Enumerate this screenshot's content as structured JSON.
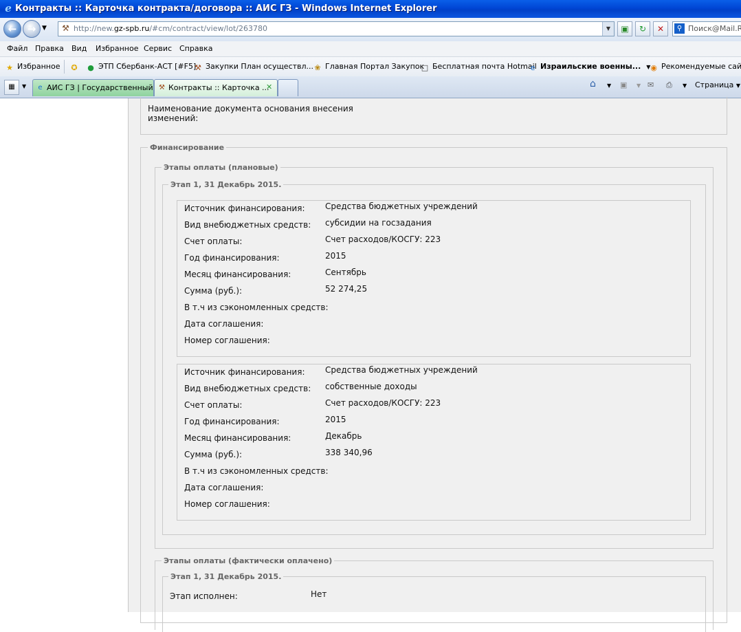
{
  "window": {
    "title": "Контракты :: Карточка контракта/договора :: АИС ГЗ - Windows Internet Explorer"
  },
  "address": {
    "url_prefix": "http://new.",
    "url_domain": "gz-spb.ru",
    "url_path": "/#cm/contract/view/lot/263780"
  },
  "search": {
    "placeholder": "Поиск@Mail.Ru"
  },
  "menu": [
    "Файл",
    "Правка",
    "Вид",
    "Избранное",
    "Сервис",
    "Справка"
  ],
  "favorites": {
    "label": "Избранное",
    "items": [
      "ЭТП Сбербанк-АСТ [#F5]",
      "Закупки  План осуществл...",
      "Главная Портал Закупок",
      "Бесплатная почта Hotmail",
      "Израильские военны...",
      "Рекомендуемые сайты"
    ]
  },
  "tabs": [
    {
      "label": "АИС ГЗ | Государственный ..."
    },
    {
      "label": "Контракты :: Карточка ..."
    }
  ],
  "commandbar": {
    "page_label": "Страница"
  },
  "doc_basis": {
    "label_line1": "Наименование документа основания внесения",
    "label_line2": "изменений:"
  },
  "financing": {
    "legend": "Финансирование",
    "planned": {
      "legend": "Этапы оплаты (плановые)",
      "stage_legend": "Этап 1, 31 Декабрь 2015.",
      "blocks": [
        {
          "source_label": "Источник финансирования:",
          "source": "Средства бюджетных учреждений",
          "kind_label": "Вид внебюджетных средств:",
          "kind": "субсидии на госзадания",
          "account_label": "Счет оплаты:",
          "account": "Счет расходов/КОСГУ: 223",
          "year_label": "Год финансирования:",
          "year": "2015",
          "month_label": "Месяц финансирования:",
          "month": "Сентябрь",
          "sum_label": "Сумма (руб.):",
          "sum": "52 274,25",
          "saved_label": "В т.ч из сэкономленных средств:",
          "agreement_date_label": "Дата соглашения:",
          "agreement_no_label": "Номер соглашения:"
        },
        {
          "source_label": "Источник финансирования:",
          "source": "Средства бюджетных учреждений",
          "kind_label": "Вид внебюджетных средств:",
          "kind": "собственные доходы",
          "account_label": "Счет оплаты:",
          "account": "Счет расходов/КОСГУ: 223",
          "year_label": "Год финансирования:",
          "year": "2015",
          "month_label": "Месяц финансирования:",
          "month": "Декабрь",
          "sum_label": "Сумма (руб.):",
          "sum": "338 340,96",
          "saved_label": "В т.ч из сэкономленных средств:",
          "agreement_date_label": "Дата соглашения:",
          "agreement_no_label": "Номер соглашения:"
        }
      ]
    },
    "actual": {
      "legend": "Этапы оплаты (фактически оплачено)",
      "stage_legend": "Этап 1, 31 Декабрь 2015.",
      "done_label": "Этап исполнен:",
      "done_value": "Нет"
    }
  }
}
